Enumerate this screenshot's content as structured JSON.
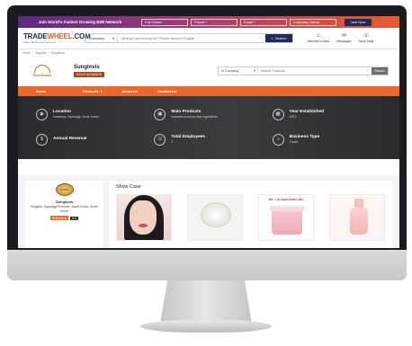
{
  "promo": {
    "text": "Join World's Fastest Growing B2B Network",
    "fields": [
      "Full Name*",
      "Phone *",
      "Email *",
      "Company Name"
    ],
    "join_label": "Join Now"
  },
  "header": {
    "logo_prefix": "TRADE",
    "logo_mid": "WHEEL",
    "logo_suffix": ".COM",
    "logo_tagline": "Stone Businesses Connect",
    "search_category": "Company",
    "search_placeholder": "What are you looking for? Please search in English",
    "search_button": "Search",
    "icons": [
      {
        "label": "Member's Area",
        "icon": "user-icon"
      },
      {
        "label": "Messages",
        "icon": "chat-icon"
      },
      {
        "label": "Need Help",
        "icon": "help-icon"
      }
    ]
  },
  "breadcrumb": [
    "Home",
    "Supplier",
    "Sunglovis"
  ],
  "company": {
    "logo_text": "SunGloves",
    "name": "Sunglovis",
    "badge": "GOLD ADVANCE",
    "search_category": "In Company",
    "search_placeholder": "Search Products",
    "search_button": "Search"
  },
  "nav": [
    "Home",
    "Products",
    "About Us",
    "Contact Us"
  ],
  "stats": [
    {
      "label": "Location",
      "value": "Hwasung, Gyeonggi, South Korea",
      "icon": "location-icon"
    },
    {
      "label": "Main Products",
      "value": "cosmetic products and ingredients",
      "icon": "box-icon"
    },
    {
      "label": "Year Established",
      "value": "2021",
      "icon": "calendar-icon"
    },
    {
      "label": "Annual Revenue",
      "value": "",
      "icon": "revenue-icon"
    },
    {
      "label": "Total Employees",
      "value": "2",
      "icon": "employees-icon"
    },
    {
      "label": "Business Type",
      "value": "Trader",
      "icon": "building-icon"
    }
  ],
  "left_card": {
    "medal_text": "GOLD",
    "name": "Sunglovis",
    "location": "Songtan, Gyeonggi Province, South Korea, South Korea",
    "stars": "★★★★★",
    "score": "5.0"
  },
  "showcase": {
    "title": "Show Case",
    "product3_banner": "No. 1 in repurchase rate"
  }
}
